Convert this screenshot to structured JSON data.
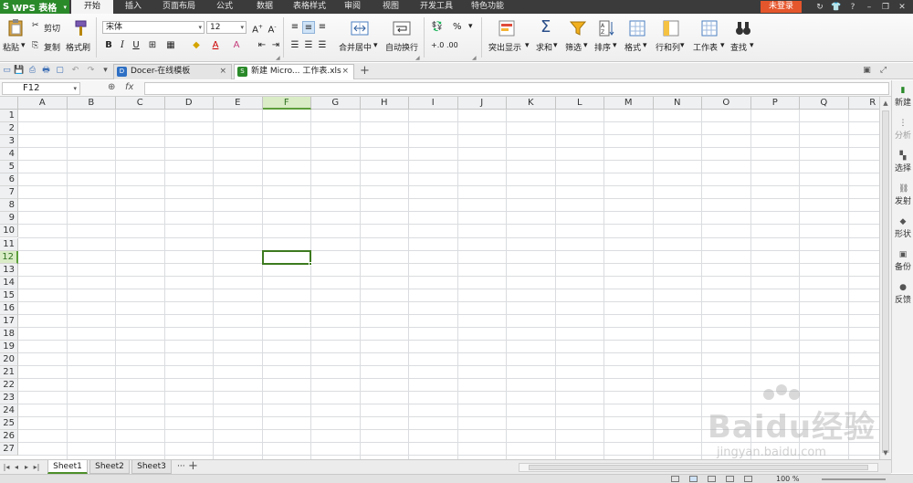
{
  "app": {
    "name": "WPS 表格",
    "logo": "S",
    "login_label": "未登录"
  },
  "menu": {
    "items": [
      {
        "label": "开始",
        "active": true
      },
      {
        "label": "插入"
      },
      {
        "label": "页面布局"
      },
      {
        "label": "公式"
      },
      {
        "label": "数据"
      },
      {
        "label": "表格样式"
      },
      {
        "label": "审阅"
      },
      {
        "label": "视图"
      },
      {
        "label": "开发工具"
      },
      {
        "label": "特色功能"
      }
    ]
  },
  "ribbon": {
    "paste": "粘贴",
    "cut": "剪切",
    "copy": "复制",
    "format_painter": "格式刷",
    "font_name": "宋体",
    "font_size": "12",
    "bold": "B",
    "italic": "I",
    "underline": "U",
    "merge_center": "合并居中",
    "auto_wrap": "自动换行",
    "percent": "%",
    "permille": "‰",
    "conditional": "突出显示",
    "sum": "求和",
    "filter": "筛选",
    "sort": "排序",
    "format": "格式",
    "row_col": "行和列",
    "worksheet": "工作表",
    "find": "查找"
  },
  "tabs": [
    {
      "label": "Docer-在线模板",
      "icon_text": "D"
    },
    {
      "label": "新建 Micro... 工作表.xls",
      "icon_text": "S",
      "active": true
    }
  ],
  "formula_bar": {
    "name_box": "F12",
    "fx": "fx"
  },
  "grid": {
    "columns": [
      "A",
      "B",
      "C",
      "D",
      "E",
      "F",
      "G",
      "H",
      "I",
      "J",
      "K",
      "L",
      "M",
      "N",
      "O",
      "P",
      "Q",
      "R"
    ],
    "rows": [
      "1",
      "2",
      "3",
      "4",
      "5",
      "6",
      "7",
      "8",
      "9",
      "10",
      "11",
      "12",
      "13",
      "14",
      "15",
      "16",
      "17",
      "18",
      "19",
      "20",
      "21",
      "22",
      "23",
      "24",
      "25",
      "26",
      "27"
    ],
    "selected_column": "F",
    "selected_row": "12"
  },
  "side_panel": [
    "新建",
    "分析",
    "选择",
    "发射",
    "形状",
    "备份",
    "反馈"
  ],
  "sheets": [
    {
      "label": "Sheet1",
      "active": true
    },
    {
      "label": "Sheet2"
    },
    {
      "label": "Sheet3"
    }
  ],
  "sheet_more": "···",
  "status": {
    "zoom": "100 %"
  },
  "watermark": {
    "main": "Baidu经验",
    "sub": "jingyan.baidu.com"
  },
  "colors": {
    "app_green": "#2a8a2a",
    "login_orange": "#e5562c",
    "selection_green": "#3d7a1f",
    "header_selected": "#d9ecc6"
  }
}
